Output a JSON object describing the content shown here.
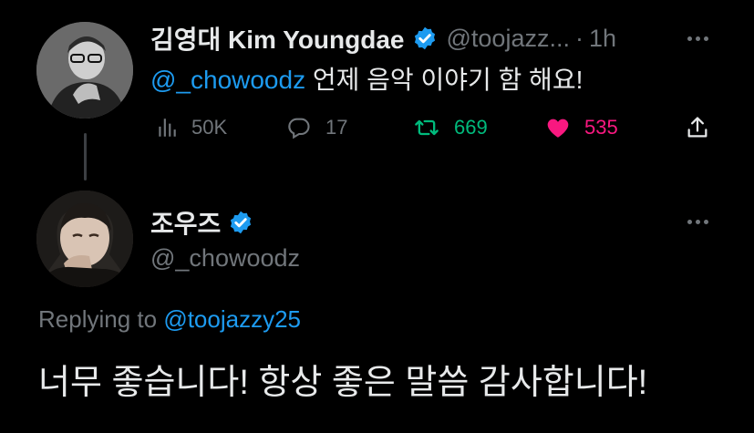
{
  "tweet": {
    "author_name": "김영대 Kim Youngdae",
    "author_handle": "@toojazz...",
    "separator": "·",
    "time": "1h",
    "mention": "@_chowoodz",
    "text": " 언제 음악 이야기 함 해요!",
    "stats": {
      "views": "50K",
      "replies": "17",
      "retweets": "669",
      "likes": "535"
    }
  },
  "reply": {
    "author_name": "조우즈",
    "author_handle": "@_chowoodz",
    "replying_prefix": "Replying to ",
    "replying_handle": "@toojazzy25",
    "text": "너무 좋습니다! 항상 좋은 말씀 감사합니다!"
  },
  "icons": [
    "verified-badge-icon",
    "more-icon",
    "views-icon",
    "reply-icon",
    "retweet-icon",
    "like-icon",
    "share-icon"
  ],
  "colors": {
    "background": "#000000",
    "text": "#e7e9ea",
    "secondary": "#71767b",
    "link": "#1d9bf0",
    "retweet": "#00ba7c",
    "like": "#f91880"
  }
}
